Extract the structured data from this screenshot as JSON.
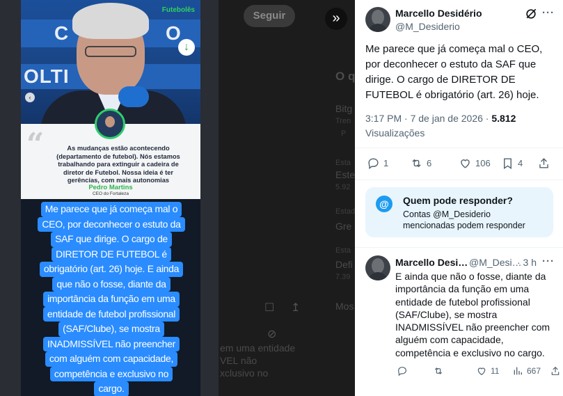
{
  "background_page": {
    "follow_label": "Seguir",
    "fragments": [
      "O q",
      "Bitg",
      "Tren",
      "P",
      "Esta",
      "Este",
      "5.92",
      "Estadi",
      "Gre",
      "Esta",
      "Defi",
      "7.39",
      "Mos",
      "em uma entidade",
      "VEL não",
      "xclusivo no"
    ]
  },
  "story": {
    "brand_logo": "Futebolês",
    "banner_words": [
      "C",
      "O",
      "OLTI"
    ],
    "quote_text": "As mudanças estão acontecendo (departamento de futebol). Nós estamos trabalhando para extinguir a cadeira de diretor de Futebol. Nossa ideia é ter gerências, com mais autonomias",
    "quote_name": "Pedro Martins",
    "quote_role": "CEO do Fortaleza",
    "bubble_lines": [
      "Me parece que já começa mal o",
      "CEO, por deconhecer o estuto da",
      "SAF que dirige. O cargo de",
      "DIRETOR DE FUTEBOL é",
      "obrigatório (art. 26) hoje. E ainda",
      "que não o fosse, diante da",
      "importância da função em uma",
      "entidade de futebol profissional",
      "(SAF/Clube), se mostra",
      "INADMISSÍVEL não preencher",
      "com alguém com capacidade,",
      "competência e exclusivo no",
      "cargo."
    ]
  },
  "tweet": {
    "author_name": "Marcello Desidério",
    "author_handle": "@M_Desiderio",
    "text": "Me parece que já começa mal o CEO, por deconhecer o estuto da SAF que dirige. O cargo de DIRETOR DE FUTEBOL é obrigatório (art. 26) hoje.",
    "time": "3:17 PM · 7 de jan de 2026 · ",
    "views": "5.812",
    "views_label": "Visualizações",
    "replies": "1",
    "reposts": "6",
    "likes": "106",
    "bookmarks": "4"
  },
  "reply_restriction": {
    "title": "Quem pode responder?",
    "description": "Contas @M_Desiderio mencionadas podem responder"
  },
  "reply": {
    "author_name": "Marcello Desi…",
    "author_handle": "@M_Desi…",
    "age": "· 3 h",
    "text": "E ainda que não o fosse, diante da importância da função em uma entidade de futebol profissional (SAF/Clube), se mostra INADMISSÍVEL não preencher com alguém com capacidade, competência e exclusivo no cargo.",
    "replies": "",
    "reposts": "",
    "likes": "11",
    "views": "667"
  },
  "colors": {
    "accent": "#1d9bf0",
    "bubble": "#2a8cff",
    "quote_name": "#2ab54e"
  }
}
